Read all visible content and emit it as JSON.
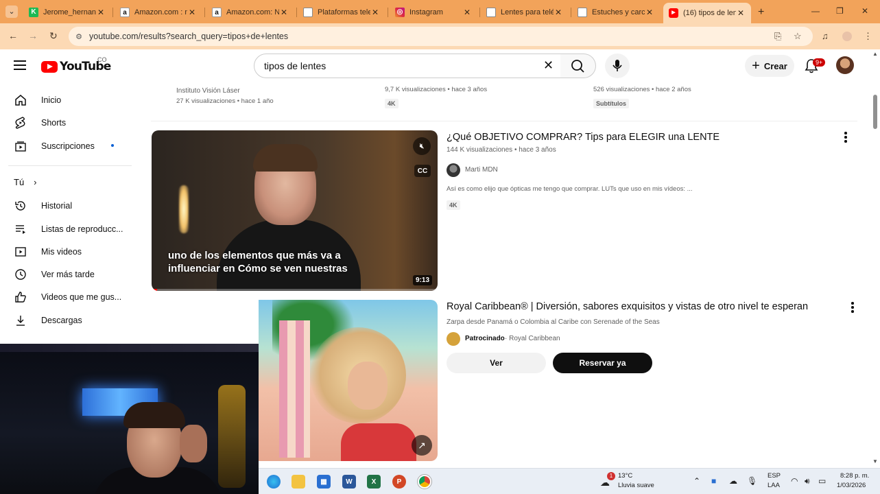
{
  "browser": {
    "tabs": [
      {
        "label": "Jerome_hernand",
        "favicon": "k-icon",
        "color": "#1db954"
      },
      {
        "label": "Amazon.com : n",
        "favicon": "amazon-icon",
        "color": "#111111"
      },
      {
        "label": "Amazon.com: NE",
        "favicon": "amazon-icon",
        "color": "#111111"
      },
      {
        "label": "Plataformas tele",
        "favicon": "doc-icon",
        "color": "#9aa0a6"
      },
      {
        "label": "Instagram",
        "favicon": "instagram-icon",
        "color": "#d6249f"
      },
      {
        "label": "Lentes para telé",
        "favicon": "doc-icon",
        "color": "#9aa0a6"
      },
      {
        "label": "Estuches y carca",
        "favicon": "doc-icon",
        "color": "#9aa0a6"
      },
      {
        "label": "(16) tipos de len",
        "favicon": "youtube-icon",
        "color": "#ff0000",
        "active": true
      }
    ],
    "new_tab": "+",
    "url": "youtube.com/results?search_query=tipos+de+lentes"
  },
  "youtube": {
    "logo_text": "YouTube",
    "country": "CO",
    "search_query": "tipos de lentes",
    "create_label": "Crear",
    "notifications_badge": "9+"
  },
  "sidebar": {
    "items": [
      {
        "label": "Inicio",
        "icon": "home-icon"
      },
      {
        "label": "Shorts",
        "icon": "shorts-icon"
      },
      {
        "label": "Suscripciones",
        "icon": "subscriptions-icon",
        "dot": true
      }
    ],
    "you_section": "Tú",
    "you_chevron": "›",
    "you_items": [
      {
        "label": "Historial",
        "icon": "history-icon"
      },
      {
        "label": "Listas de reproducc...",
        "icon": "playlists-icon"
      },
      {
        "label": "Mis videos",
        "icon": "my-videos-icon"
      },
      {
        "label": "Ver más tarde",
        "icon": "watch-later-icon"
      },
      {
        "label": "Videos que me gus...",
        "icon": "liked-icon"
      },
      {
        "label": "Descargas",
        "icon": "downloads-icon"
      }
    ]
  },
  "previous_row": {
    "col1": {
      "channel": "Instituto Visión Láser",
      "meta": "27 K visualizaciones • hace 1 año"
    },
    "col2": {
      "meta": "9,7 K visualizaciones • hace 3 años",
      "badge": "4K"
    },
    "col3": {
      "meta": "526 visualizaciones • hace 2 años",
      "badge": "Subtítulos"
    }
  },
  "results": [
    {
      "title": "¿Qué OBJETIVO COMPRAR? Tips para ELEGIR una LENTE",
      "meta": "144 K visualizaciones • hace 3 años",
      "channel": "Marti MDN",
      "description": "Así es como elijo que ópticas me tengo que comprar. LUTs que uso en mis vídeos: ...",
      "badge": "4K",
      "duration": "9:13",
      "caption_line1": "uno de los elementos que más va a",
      "caption_line2": "influenciar en Cómo se ven nuestras",
      "cc_label": "CC",
      "progress": 0.02
    },
    {
      "title": "Royal Caribbean® | Diversión, sabores exquisitos y vistas de otro nivel te esperan",
      "subtitle": "Zarpa desde Panamá o Colombia al Caribe con Serenade of the Seas",
      "sponsored_label": "Patrocinado",
      "advertiser": "· Royal Caribbean",
      "btn_view": "Ver",
      "btn_book": "Reservar ya"
    }
  ],
  "taskbar": {
    "apps": [
      {
        "name": "edge-icon",
        "color": "#1f8ad2"
      },
      {
        "name": "file-explorer-icon",
        "color": "#f3c341"
      },
      {
        "name": "store-icon",
        "color": "#2a6fd1"
      },
      {
        "name": "word-icon",
        "color": "#2b579a",
        "letter": "W"
      },
      {
        "name": "excel-icon",
        "color": "#217346",
        "letter": "X"
      },
      {
        "name": "powerpoint-icon",
        "color": "#d24726",
        "letter": "P"
      },
      {
        "name": "chrome-icon",
        "color": "#db4437"
      }
    ],
    "weather_badge": "1",
    "temperature": "13°C",
    "weather": "Lluvia suave",
    "language": "ESP",
    "region": "LAA",
    "time": "8:28 p. m.",
    "date": "1/03/2026"
  }
}
